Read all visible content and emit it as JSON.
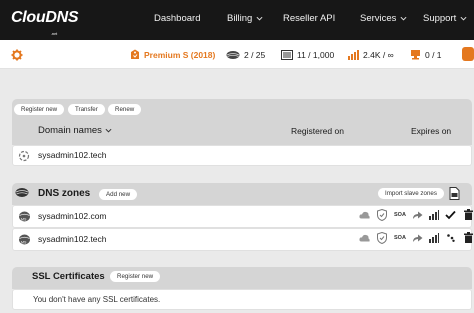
{
  "brand": {
    "logo_text": "ClouDNS",
    "logo_suffix": ".net"
  },
  "nav": {
    "dashboard": "Dashboard",
    "billing": "Billing",
    "reseller_api": "Reseller API",
    "services": "Services",
    "support": "Support"
  },
  "status": {
    "plan": "Premium S (2018)",
    "zones": "2 / 25",
    "records": "11 / 1,000",
    "queries": "2.4K / ∞",
    "slaves": "0 / 1"
  },
  "domains": {
    "buttons": {
      "register": "Register new",
      "transfer": "Transfer",
      "renew": "Renew"
    },
    "columns": {
      "name": "Domain names",
      "registered": "Registered on",
      "expires": "Expires on"
    },
    "rows": [
      {
        "name": "sysadmin102.tech"
      }
    ]
  },
  "dns_zones": {
    "title": "DNS zones",
    "add_label": "Add new",
    "import_label": "Import slave zones",
    "rows": [
      {
        "name": "sysadmin102.com"
      },
      {
        "name": "sysadmin102.tech"
      }
    ]
  },
  "ssl": {
    "title": "SSL Certificates",
    "register_label": "Register new",
    "empty_message": "You don't have any SSL certificates."
  },
  "colors": {
    "accent": "#e4781f",
    "topbar": "#171717",
    "panel_header": "#d5d5d5"
  }
}
